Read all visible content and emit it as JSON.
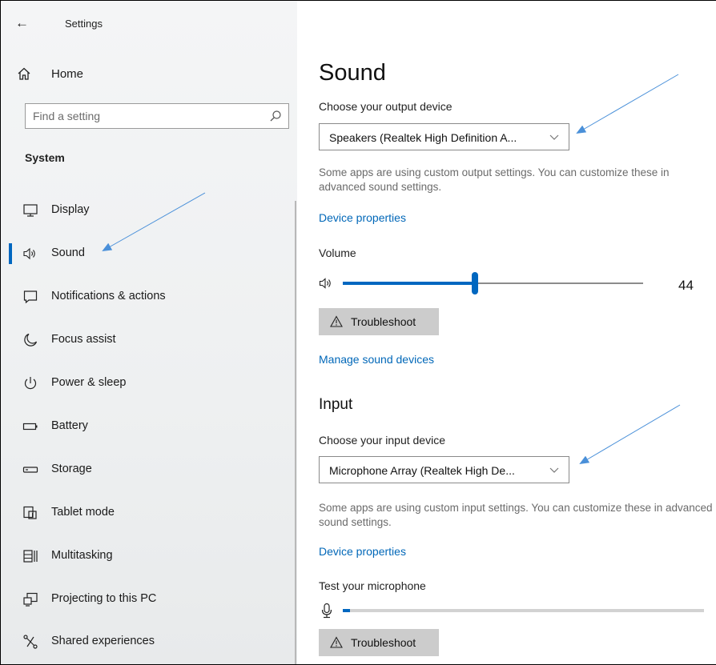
{
  "window": {
    "back_glyph": "←",
    "title": "Settings"
  },
  "sidebar": {
    "home_label": "Home",
    "search_placeholder": "Find a setting",
    "section_label": "System",
    "items": [
      {
        "label": "Display",
        "icon": "monitor-icon",
        "active": false
      },
      {
        "label": "Sound",
        "icon": "speaker-icon",
        "active": true
      },
      {
        "label": "Notifications & actions",
        "icon": "notification-icon",
        "active": false
      },
      {
        "label": "Focus assist",
        "icon": "moon-icon",
        "active": false
      },
      {
        "label": "Power & sleep",
        "icon": "power-icon",
        "active": false
      },
      {
        "label": "Battery",
        "icon": "battery-icon",
        "active": false
      },
      {
        "label": "Storage",
        "icon": "storage-icon",
        "active": false
      },
      {
        "label": "Tablet mode",
        "icon": "tablet-icon",
        "active": false
      },
      {
        "label": "Multitasking",
        "icon": "multitasking-icon",
        "active": false
      },
      {
        "label": "Projecting to this PC",
        "icon": "projecting-icon",
        "active": false
      },
      {
        "label": "Shared experiences",
        "icon": "shared-experiences-icon",
        "active": false
      }
    ]
  },
  "sound": {
    "heading": "Sound",
    "output_label": "Choose your output device",
    "output_device": "Speakers (Realtek High Definition A...",
    "output_description": "Some apps are using custom output settings. You can customize these in advanced sound settings.",
    "device_properties_link": "Device properties",
    "volume_label": "Volume",
    "volume_value": "44",
    "volume_level_percent": 44,
    "troubleshoot_label": "Troubleshoot",
    "manage_devices_link": "Manage sound devices"
  },
  "input": {
    "heading": "Input",
    "input_label": "Choose your input device",
    "input_device": "Microphone Array (Realtek High De...",
    "input_description": "Some apps are using custom input settings. You can customize these in advanced sound settings.",
    "device_properties_link": "Device properties",
    "test_mic_label": "Test your microphone",
    "mic_level_percent": 2,
    "troubleshoot_label": "Troubleshoot"
  },
  "colors": {
    "accent": "#0067c0",
    "link": "#0067b8",
    "annotation_arrow": "#4a90d9",
    "button_bg": "#cccccc"
  }
}
